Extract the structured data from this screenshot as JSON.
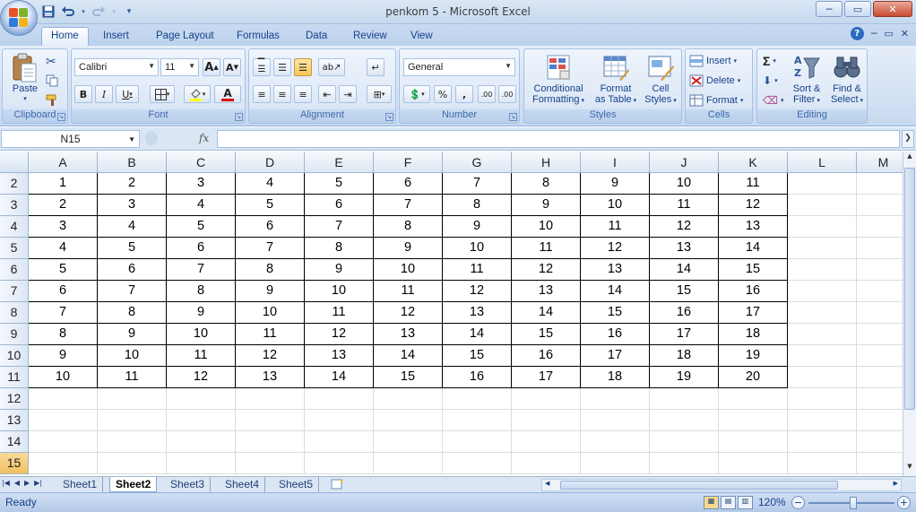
{
  "window": {
    "title": "penkom 5 - Microsoft Excel",
    "minimize_glyph": "─",
    "restore_glyph": "▭",
    "close_glyph": "✕"
  },
  "qat": [
    "save-icon",
    "undo-icon",
    "redo-icon",
    "customize-icon"
  ],
  "ribbon_tabs": [
    "Home",
    "Insert",
    "Page Layout",
    "Formulas",
    "Data",
    "Review",
    "View"
  ],
  "ribbon": {
    "clipboard": {
      "label": "Clipboard",
      "paste": "Paste"
    },
    "font": {
      "label": "Font",
      "name": "Calibri",
      "size": "11",
      "bold": "B",
      "italic": "I",
      "underline": "U",
      "grow": "A",
      "shrink": "A",
      "fontcolor": "A"
    },
    "alignment": {
      "label": "Alignment"
    },
    "number": {
      "label": "Number",
      "format": "General",
      "percent": "%",
      "comma": ",",
      "inc_dec": ".00",
      "dec_dec": ".00"
    },
    "styles": {
      "label": "Styles",
      "cond_1": "Conditional",
      "cond_2": "Formatting",
      "fmt_1": "Format",
      "fmt_2": "as Table",
      "cell_1": "Cell",
      "cell_2": "Styles"
    },
    "cells": {
      "label": "Cells",
      "insert": "Insert",
      "delete": "Delete",
      "format": "Format"
    },
    "editing": {
      "label": "Editing",
      "sort_1": "Sort &",
      "sort_2": "Filter",
      "find_1": "Find &",
      "find_2": "Select"
    }
  },
  "formula_bar": {
    "name_box": "N15",
    "fx": "fx",
    "value": ""
  },
  "columns": [
    "A",
    "B",
    "C",
    "D",
    "E",
    "F",
    "G",
    "H",
    "I",
    "J",
    "K",
    "L",
    "M"
  ],
  "rows": [
    "2",
    "3",
    "4",
    "5",
    "6",
    "7",
    "8",
    "9",
    "10",
    "11",
    "12",
    "13",
    "14",
    "15"
  ],
  "selected_row": "15",
  "table": [
    [
      "1",
      "2",
      "3",
      "4",
      "5",
      "6",
      "7",
      "8",
      "9",
      "10",
      "11"
    ],
    [
      "2",
      "3",
      "4",
      "5",
      "6",
      "7",
      "8",
      "9",
      "10",
      "11",
      "12"
    ],
    [
      "3",
      "4",
      "5",
      "6",
      "7",
      "8",
      "9",
      "10",
      "11",
      "12",
      "13"
    ],
    [
      "4",
      "5",
      "6",
      "7",
      "8",
      "9",
      "10",
      "11",
      "12",
      "13",
      "14"
    ],
    [
      "5",
      "6",
      "7",
      "8",
      "9",
      "10",
      "11",
      "12",
      "13",
      "14",
      "15"
    ],
    [
      "6",
      "7",
      "8",
      "9",
      "10",
      "11",
      "12",
      "13",
      "14",
      "15",
      "16"
    ],
    [
      "7",
      "8",
      "9",
      "10",
      "11",
      "12",
      "13",
      "14",
      "15",
      "16",
      "17"
    ],
    [
      "8",
      "9",
      "10",
      "11",
      "12",
      "13",
      "14",
      "15",
      "16",
      "17",
      "18"
    ],
    [
      "9",
      "10",
      "11",
      "12",
      "13",
      "14",
      "15",
      "16",
      "17",
      "18",
      "19"
    ],
    [
      "10",
      "11",
      "12",
      "13",
      "14",
      "15",
      "16",
      "17",
      "18",
      "19",
      "20"
    ]
  ],
  "sheets": [
    "Sheet1",
    "Sheet2",
    "Sheet3",
    "Sheet4",
    "Sheet5"
  ],
  "active_sheet": "Sheet2",
  "status": {
    "text": "Ready",
    "zoom": "120%",
    "zoom_out": "−",
    "zoom_in": "+"
  },
  "colors": {
    "accent": "#15428b",
    "selection": "#f1c15f",
    "ribbon_bg": "#d2e0f3"
  }
}
